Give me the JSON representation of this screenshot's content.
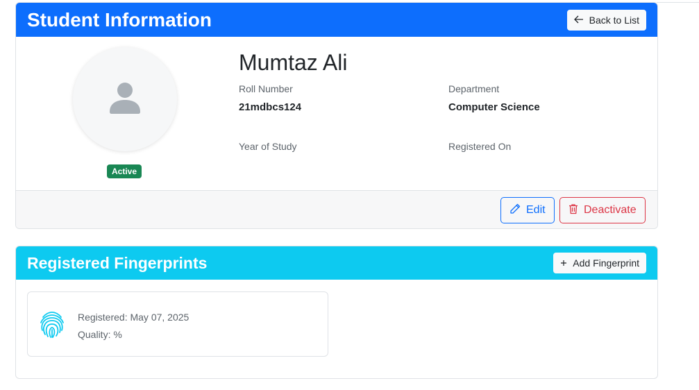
{
  "student_card": {
    "title": "Student Information",
    "back_button": "Back to List",
    "name": "Mumtaz Ali",
    "status": "Active",
    "fields": {
      "roll_number": {
        "label": "Roll Number",
        "value": "21mdbcs124"
      },
      "department": {
        "label": "Department",
        "value": "Computer Science"
      },
      "year_of_study": {
        "label": "Year of Study",
        "value": ""
      },
      "registered_on": {
        "label": "Registered On",
        "value": ""
      }
    },
    "edit_button": "Edit",
    "deactivate_button": "Deactivate"
  },
  "fingerprints_card": {
    "title": "Registered Fingerprints",
    "add_button": "Add Fingerprint",
    "items": [
      {
        "registered": "Registered: May 07, 2025",
        "quality": "Quality: %"
      }
    ]
  },
  "colors": {
    "primary": "#0d6efd",
    "info": "#0dcaf0",
    "success": "#198754",
    "danger": "#dc3545"
  },
  "icons": {
    "back": "arrow-left-icon",
    "avatar": "user-icon",
    "edit": "pencil-icon",
    "deactivate": "trash-icon",
    "add": "plus-icon",
    "fingerprint": "fingerprint-icon"
  }
}
